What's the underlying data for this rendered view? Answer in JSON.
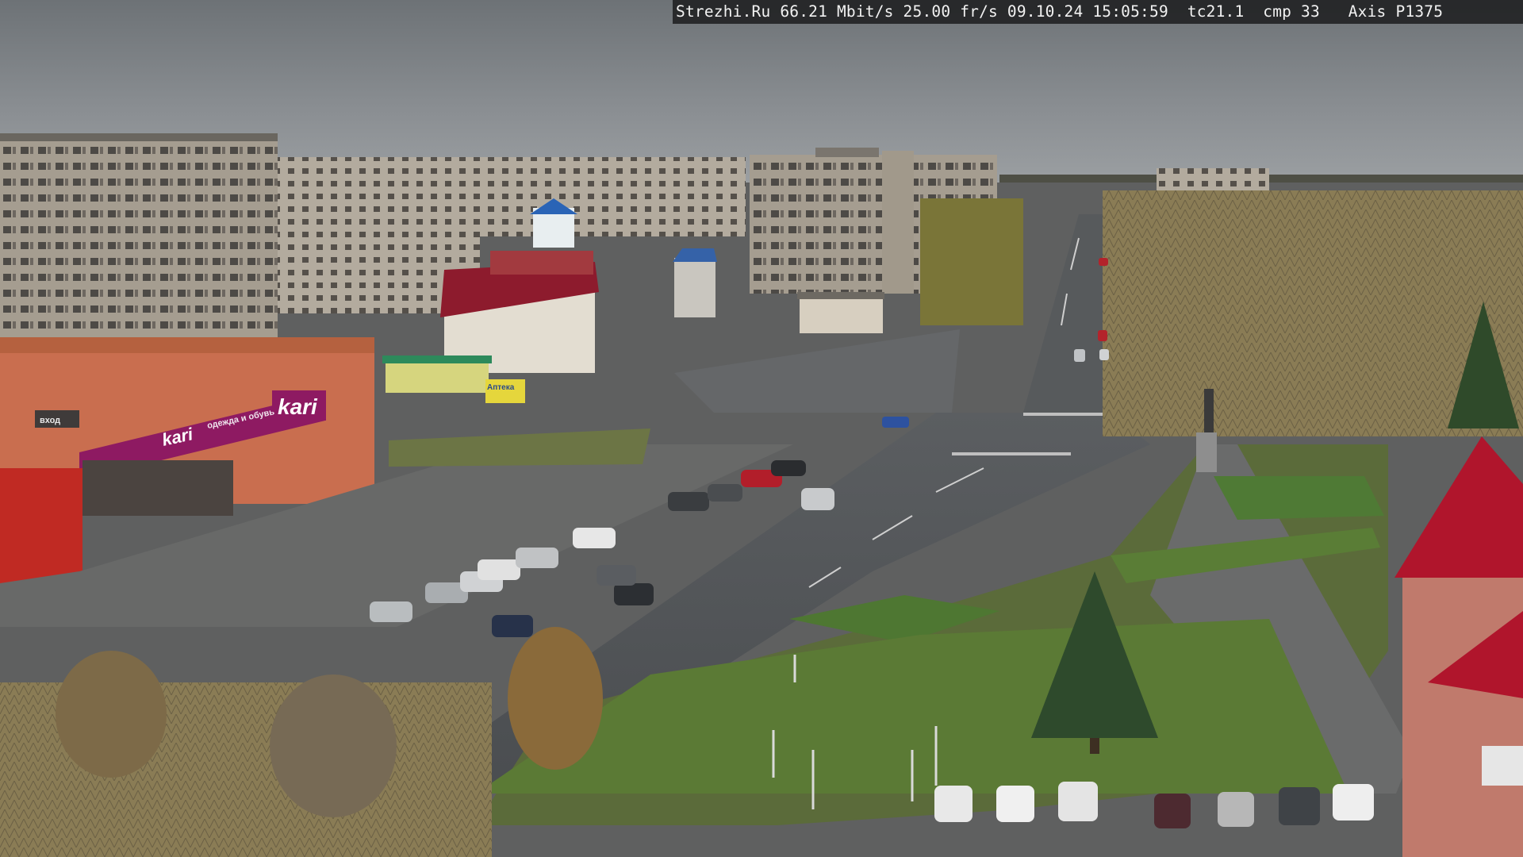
{
  "overlay": {
    "text": "Strezhi.Ru 66.21 Mbit/s 25.00 fr/s 09.10.24 15:05:59  tc21.1  cmp 33   Axis P1375"
  },
  "signs": {
    "kari_main": "kari",
    "kari_lower": "kari",
    "kari_small": "обувь",
    "kari_banner": "одежда и обувь",
    "storefront_left": "вход",
    "apteka": "Аптека"
  },
  "colors": {
    "sky": "#83878b",
    "kari_magenta": "#8e1a62",
    "roof_red": "#b0152c"
  }
}
